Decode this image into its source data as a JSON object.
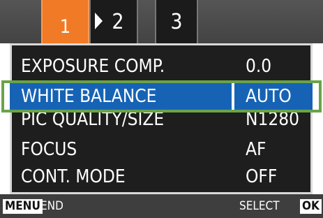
{
  "tabs": [
    {
      "label": "1",
      "active": true
    },
    {
      "label": "2",
      "active": false
    },
    {
      "label": "3",
      "active": false
    }
  ],
  "menu": {
    "rows": [
      {
        "label": "EXPOSURE COMP.",
        "value": "0.0"
      },
      {
        "label": "WHITE BALANCE",
        "value": "AUTO",
        "selected": true
      },
      {
        "label": "PIC QUALITY/SIZE",
        "value": "N1280"
      },
      {
        "label": "FOCUS",
        "value": "AF"
      },
      {
        "label": "CONT. MODE",
        "value": "OFF"
      }
    ]
  },
  "footer": {
    "menu_key": "MENU",
    "menu_action": "END",
    "select_action": "SELECT",
    "ok_key": "OK"
  },
  "colors": {
    "active_tab": "#f07a26",
    "selection": "#1663b5",
    "highlight_outline": "#6aa349"
  }
}
